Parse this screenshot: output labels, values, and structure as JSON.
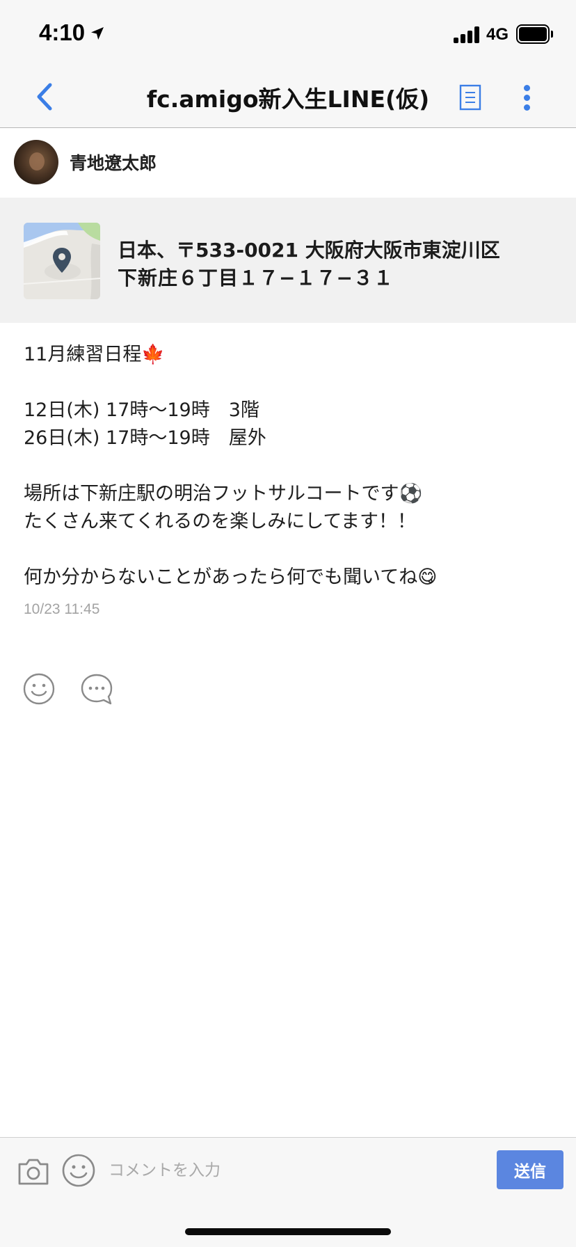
{
  "status_bar": {
    "time": "4:10",
    "network": "4G",
    "icons": [
      "location-arrow-icon",
      "signal-icon",
      "battery-icon"
    ]
  },
  "nav": {
    "title": "fc.amigo新入生LINE(仮)",
    "icons": [
      "back-chevron-icon",
      "note-icon",
      "more-vertical-icon"
    ],
    "accent_color": "#3b7ee6"
  },
  "post": {
    "author": "青地遼太郎",
    "location": {
      "line1": "日本、〒533-0021 大阪府大阪市東淀川区",
      "line2": "下新庄６丁目１７−１７−３１",
      "icon": "map-pin-icon"
    },
    "lines": [
      "11月練習日程🍁",
      "",
      "12日(木) 17時〜19時　3階",
      "26日(木) 17時〜19時　屋外",
      "",
      "場所は下新庄駅の明治フットサルコートです⚽️",
      "たくさん来てくれるのを楽しみにしてます！！",
      "",
      "何か分からないことがあったら何でも聞いてね😋"
    ],
    "timestamp": "10/23 11:45",
    "reactions": [
      "smiley-icon",
      "comment-bubble-icon"
    ]
  },
  "comment_bar": {
    "placeholder": "コメントを入力",
    "value": "",
    "send_label": "送信",
    "send_color": "#5b86e0",
    "icons": [
      "camera-icon",
      "emoji-icon"
    ]
  }
}
